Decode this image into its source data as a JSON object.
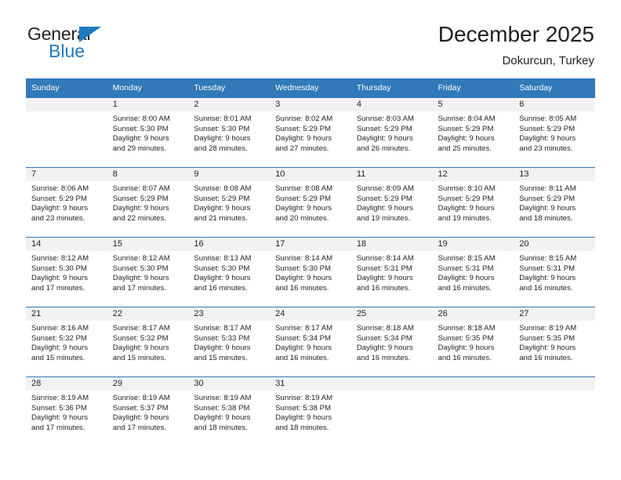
{
  "brand": {
    "name_top": "General",
    "name_bottom": "Blue",
    "accent_color": "#1f7ac0",
    "triangle_icon": "brand-triangle-icon"
  },
  "header": {
    "title": "December 2025",
    "subtitle": "Dokurcun, Turkey"
  },
  "theme": {
    "header_bg": "#3179b8",
    "header_text": "#ffffff",
    "daynum_bg": "#f2f2f2",
    "body_text": "#231f20"
  },
  "weekdays": [
    "Sunday",
    "Monday",
    "Tuesday",
    "Wednesday",
    "Thursday",
    "Friday",
    "Saturday"
  ],
  "weeks": [
    [
      {
        "day": "",
        "info": ""
      },
      {
        "day": "1",
        "info": "Sunrise: 8:00 AM\nSunset: 5:30 PM\nDaylight: 9 hours\nand 29 minutes."
      },
      {
        "day": "2",
        "info": "Sunrise: 8:01 AM\nSunset: 5:30 PM\nDaylight: 9 hours\nand 28 minutes."
      },
      {
        "day": "3",
        "info": "Sunrise: 8:02 AM\nSunset: 5:29 PM\nDaylight: 9 hours\nand 27 minutes."
      },
      {
        "day": "4",
        "info": "Sunrise: 8:03 AM\nSunset: 5:29 PM\nDaylight: 9 hours\nand 26 minutes."
      },
      {
        "day": "5",
        "info": "Sunrise: 8:04 AM\nSunset: 5:29 PM\nDaylight: 9 hours\nand 25 minutes."
      },
      {
        "day": "6",
        "info": "Sunrise: 8:05 AM\nSunset: 5:29 PM\nDaylight: 9 hours\nand 23 minutes."
      }
    ],
    [
      {
        "day": "7",
        "info": "Sunrise: 8:06 AM\nSunset: 5:29 PM\nDaylight: 9 hours\nand 23 minutes."
      },
      {
        "day": "8",
        "info": "Sunrise: 8:07 AM\nSunset: 5:29 PM\nDaylight: 9 hours\nand 22 minutes."
      },
      {
        "day": "9",
        "info": "Sunrise: 8:08 AM\nSunset: 5:29 PM\nDaylight: 9 hours\nand 21 minutes."
      },
      {
        "day": "10",
        "info": "Sunrise: 8:08 AM\nSunset: 5:29 PM\nDaylight: 9 hours\nand 20 minutes."
      },
      {
        "day": "11",
        "info": "Sunrise: 8:09 AM\nSunset: 5:29 PM\nDaylight: 9 hours\nand 19 minutes."
      },
      {
        "day": "12",
        "info": "Sunrise: 8:10 AM\nSunset: 5:29 PM\nDaylight: 9 hours\nand 19 minutes."
      },
      {
        "day": "13",
        "info": "Sunrise: 8:11 AM\nSunset: 5:29 PM\nDaylight: 9 hours\nand 18 minutes."
      }
    ],
    [
      {
        "day": "14",
        "info": "Sunrise: 8:12 AM\nSunset: 5:30 PM\nDaylight: 9 hours\nand 17 minutes."
      },
      {
        "day": "15",
        "info": "Sunrise: 8:12 AM\nSunset: 5:30 PM\nDaylight: 9 hours\nand 17 minutes."
      },
      {
        "day": "16",
        "info": "Sunrise: 8:13 AM\nSunset: 5:30 PM\nDaylight: 9 hours\nand 16 minutes."
      },
      {
        "day": "17",
        "info": "Sunrise: 8:14 AM\nSunset: 5:30 PM\nDaylight: 9 hours\nand 16 minutes."
      },
      {
        "day": "18",
        "info": "Sunrise: 8:14 AM\nSunset: 5:31 PM\nDaylight: 9 hours\nand 16 minutes."
      },
      {
        "day": "19",
        "info": "Sunrise: 8:15 AM\nSunset: 5:31 PM\nDaylight: 9 hours\nand 16 minutes."
      },
      {
        "day": "20",
        "info": "Sunrise: 8:15 AM\nSunset: 5:31 PM\nDaylight: 9 hours\nand 16 minutes."
      }
    ],
    [
      {
        "day": "21",
        "info": "Sunrise: 8:16 AM\nSunset: 5:32 PM\nDaylight: 9 hours\nand 15 minutes."
      },
      {
        "day": "22",
        "info": "Sunrise: 8:17 AM\nSunset: 5:32 PM\nDaylight: 9 hours\nand 15 minutes."
      },
      {
        "day": "23",
        "info": "Sunrise: 8:17 AM\nSunset: 5:33 PM\nDaylight: 9 hours\nand 15 minutes."
      },
      {
        "day": "24",
        "info": "Sunrise: 8:17 AM\nSunset: 5:34 PM\nDaylight: 9 hours\nand 16 minutes."
      },
      {
        "day": "25",
        "info": "Sunrise: 8:18 AM\nSunset: 5:34 PM\nDaylight: 9 hours\nand 16 minutes."
      },
      {
        "day": "26",
        "info": "Sunrise: 8:18 AM\nSunset: 5:35 PM\nDaylight: 9 hours\nand 16 minutes."
      },
      {
        "day": "27",
        "info": "Sunrise: 8:19 AM\nSunset: 5:35 PM\nDaylight: 9 hours\nand 16 minutes."
      }
    ],
    [
      {
        "day": "28",
        "info": "Sunrise: 8:19 AM\nSunset: 5:36 PM\nDaylight: 9 hours\nand 17 minutes."
      },
      {
        "day": "29",
        "info": "Sunrise: 8:19 AM\nSunset: 5:37 PM\nDaylight: 9 hours\nand 17 minutes."
      },
      {
        "day": "30",
        "info": "Sunrise: 8:19 AM\nSunset: 5:38 PM\nDaylight: 9 hours\nand 18 minutes."
      },
      {
        "day": "31",
        "info": "Sunrise: 8:19 AM\nSunset: 5:38 PM\nDaylight: 9 hours\nand 18 minutes."
      },
      {
        "day": "",
        "info": ""
      },
      {
        "day": "",
        "info": ""
      },
      {
        "day": "",
        "info": ""
      }
    ]
  ]
}
